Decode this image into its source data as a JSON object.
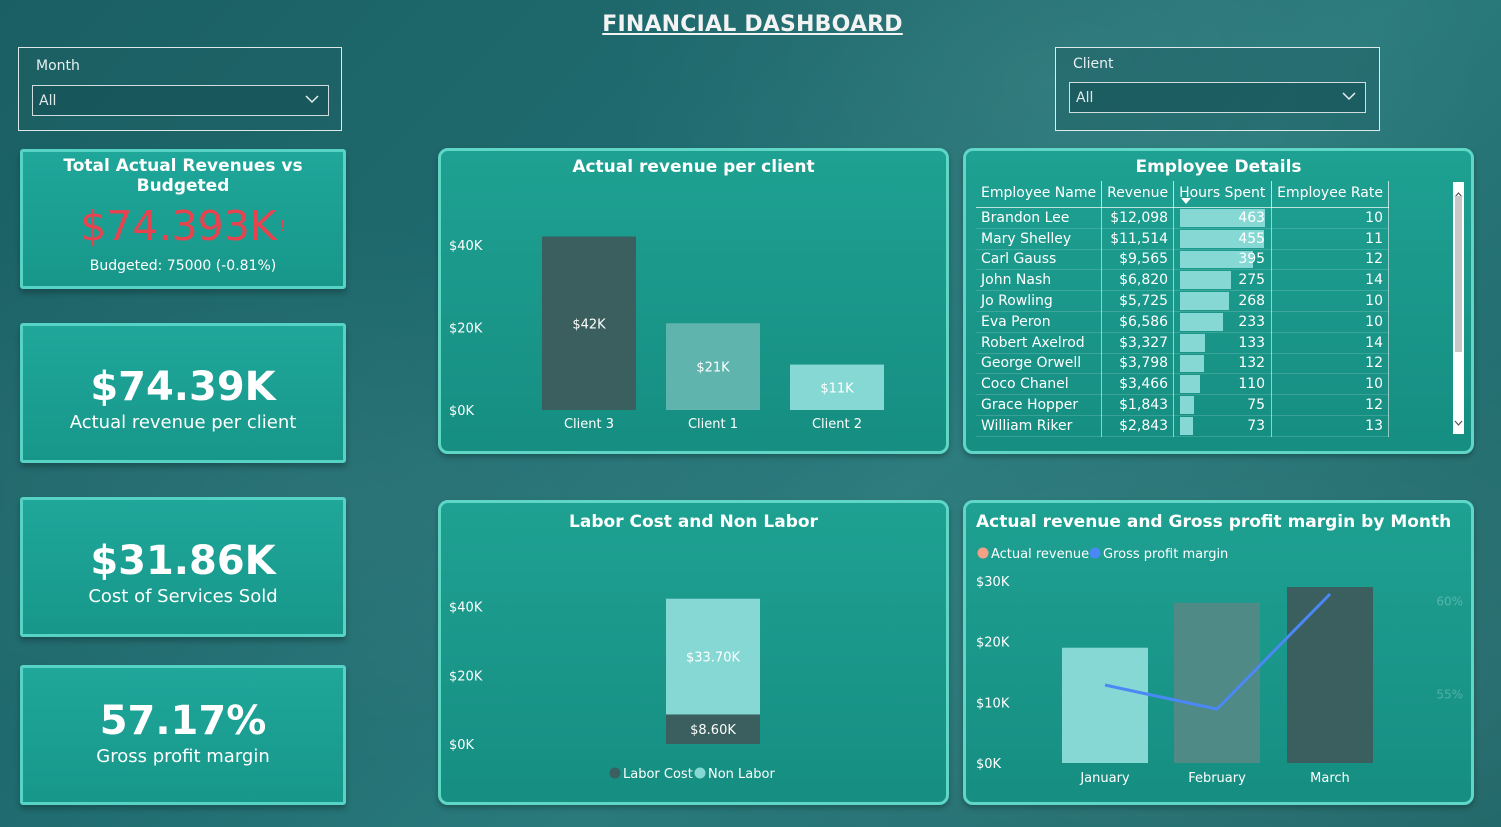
{
  "page": {
    "title": "FINANCIAL DASHBOARD"
  },
  "colors": {
    "kpi_bg": "#1fa79a",
    "alert_red": "#e8424f",
    "dark_bar": "#3a5f5e",
    "mid_bar": "#5fb5ad",
    "light_bar": "#86d8d4",
    "line_blue": "#4a88f5",
    "legend_orange": "#f4a087"
  },
  "slicers": {
    "month": {
      "label": "Month",
      "value": "All",
      "icon": "chevron-down-icon"
    },
    "client": {
      "label": "Client",
      "value": "All",
      "icon": "chevron-down-icon"
    }
  },
  "kpis": {
    "revenue_vs_budget": {
      "title": "Total Actual Revenues vs Budgeted",
      "value": "$74.393K",
      "flag": "!",
      "sub": "Budgeted: 75000 (-0.81%)"
    },
    "actual_revenue": {
      "value": "$74.39K",
      "label": "Actual revenue per client"
    },
    "cost_of_services": {
      "value": "$31.86K",
      "label": "Cost of Services Sold"
    },
    "gross_margin": {
      "value": "57.17%",
      "label": "Gross profit margin"
    }
  },
  "employee_table": {
    "title": "Employee Details",
    "columns": [
      "Employee Name",
      "Revenue",
      "Hours Spent",
      "Employee Rate"
    ],
    "sort_icon": "sort-down-icon",
    "rows": [
      {
        "name": "Brandon Lee",
        "revenue": "$12,098",
        "hours": 463,
        "rate": "10"
      },
      {
        "name": "Mary Shelley",
        "revenue": "$11,514",
        "hours": 455,
        "rate": "11"
      },
      {
        "name": "Carl Gauss",
        "revenue": "$9,565",
        "hours": 395,
        "rate": "12"
      },
      {
        "name": "John Nash",
        "revenue": "$6,820",
        "hours": 275,
        "rate": "14"
      },
      {
        "name": "Jo Rowling",
        "revenue": "$5,725",
        "hours": 268,
        "rate": "10"
      },
      {
        "name": "Eva Peron",
        "revenue": "$6,586",
        "hours": 233,
        "rate": "10"
      },
      {
        "name": "Robert Axelrod",
        "revenue": "$3,327",
        "hours": 133,
        "rate": "14"
      },
      {
        "name": "George Orwell",
        "revenue": "$3,798",
        "hours": 132,
        "rate": "12"
      },
      {
        "name": "Coco Chanel",
        "revenue": "$3,466",
        "hours": 110,
        "rate": "10"
      },
      {
        "name": "Grace Hopper",
        "revenue": "$1,843",
        "hours": 75,
        "rate": "12"
      },
      {
        "name": "William Riker",
        "revenue": "$2,843",
        "hours": 73,
        "rate": "13"
      }
    ]
  },
  "chart_data": [
    {
      "id": "revenue_per_client",
      "type": "bar",
      "title": "Actual revenue per client",
      "categories": [
        "Client 3",
        "Client 1",
        "Client 2"
      ],
      "values": [
        42,
        21,
        11
      ],
      "data_labels": [
        "$42K",
        "$21K",
        "$11K"
      ],
      "bar_colors": [
        "#3a5f5e",
        "#5fb5ad",
        "#86d8d4"
      ],
      "ytick_labels": [
        "$0K",
        "$20K",
        "$40K"
      ],
      "ylim": [
        0,
        46
      ],
      "unit": "thousands USD"
    },
    {
      "id": "labor_cost",
      "type": "bar",
      "stacked": true,
      "title": "Labor Cost and Non Labor",
      "categories": [
        ""
      ],
      "series": [
        {
          "name": "Labor Cost",
          "values": [
            8.6
          ],
          "label": "$8.60K",
          "color": "#3a5f5e"
        },
        {
          "name": "Non Labor",
          "values": [
            33.7
          ],
          "label": "$33.70K",
          "color": "#86d8d4"
        }
      ],
      "ytick_labels": [
        "$0K",
        "$20K",
        "$40K"
      ],
      "ylim": [
        0,
        46
      ],
      "legend": "bottom"
    },
    {
      "id": "revenue_margin_by_month",
      "type": "bar",
      "combo": "bar+line",
      "title": "Actual revenue and Gross profit margin by Month",
      "categories": [
        "January",
        "February",
        "March"
      ],
      "series": [
        {
          "name": "Actual revenue",
          "values": [
            19,
            26.4,
            29
          ],
          "colors": [
            "#86d8d4",
            "#4f8a87",
            "#3a5f5e"
          ],
          "legend_color": "#f4a087"
        },
        {
          "name": "Gross profit margin",
          "values": [
            55.5,
            54.2,
            60.4
          ],
          "color": "#4a88f5",
          "axis": "right"
        }
      ],
      "ytick_labels": [
        "$0K",
        "$10K",
        "$20K",
        "$30K"
      ],
      "ylim": [
        0,
        30
      ],
      "y2tick_labels": [
        "55%",
        "60%"
      ],
      "y2lim": [
        51.3,
        61.1
      ],
      "legend": "top-left"
    }
  ]
}
